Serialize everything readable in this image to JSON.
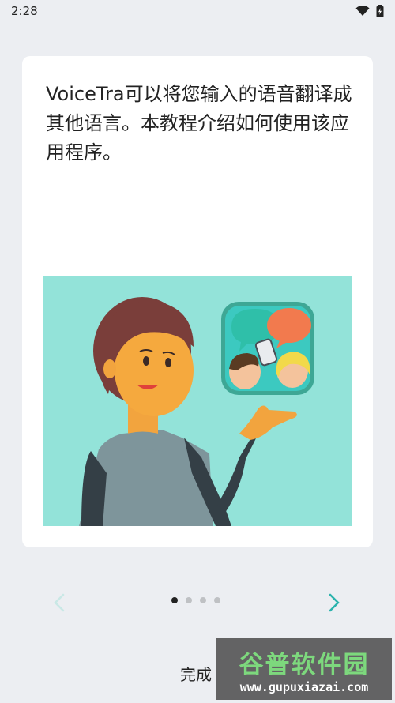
{
  "status_bar": {
    "time": "2:28"
  },
  "intro": {
    "text": "VoiceTra可以将您输入的语音翻译成其他语言。本教程介绍如何使用该应用程序。"
  },
  "pager": {
    "page_count": 4,
    "current_page": 1
  },
  "footer": {
    "done_label": "完成"
  },
  "watermark": {
    "title": "谷普软件园",
    "url": "www.gupuxiazai.com"
  },
  "colors": {
    "accent": "#2bb3ad",
    "illustration_bg": "#93e3d9",
    "background": "#eceef2"
  }
}
